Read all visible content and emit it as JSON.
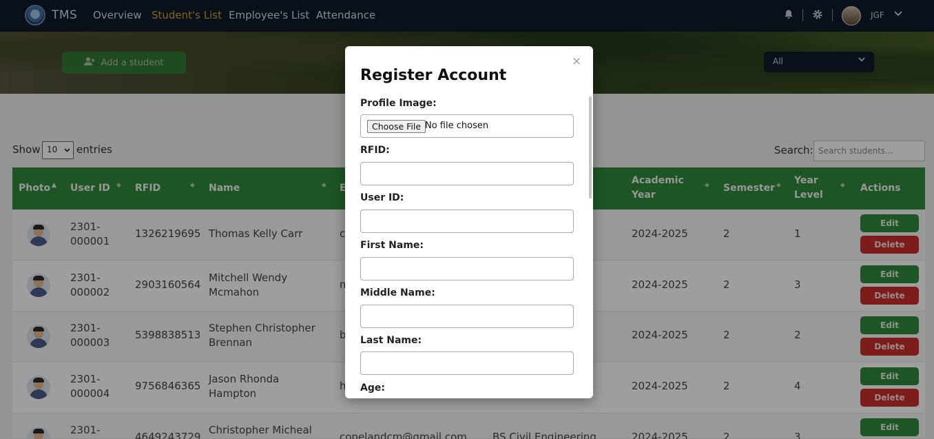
{
  "nav": {
    "brand": "TMS",
    "links": [
      "Overview",
      "Student's List",
      "Employee's List",
      "Attendance"
    ],
    "active_index": 1,
    "user": "JGF",
    "icons": [
      "bell-icon",
      "gear-icon",
      "chevron-down-icon"
    ]
  },
  "toolbar": {
    "add_label": "Add a student",
    "filter_value": "All"
  },
  "list": {
    "show_label": "Show",
    "page_size": "10",
    "entries_label": "entries",
    "search_label": "Search:",
    "search_placeholder": "Search students..."
  },
  "table": {
    "headers": {
      "photo": "Photo",
      "user_id": "User ID",
      "rfid": "RFID",
      "name": "Name",
      "email": "E",
      "academic_year": "Academic Year",
      "semester": "Semester",
      "year_level": "Year Level",
      "actions": "Actions"
    },
    "rows": [
      {
        "user_id": "2301-000001",
        "rfid": "1326219695",
        "name": "Thomas Kelly Carr",
        "email": "c",
        "course": "",
        "academic_year": "2024-2025",
        "semester": "2",
        "year_level": "1"
      },
      {
        "user_id": "2301-000002",
        "rfid": "2903160564",
        "name": "Mitchell Wendy Mcmahon",
        "email": "m",
        "course": "",
        "academic_year": "2024-2025",
        "semester": "2",
        "year_level": "3"
      },
      {
        "user_id": "2301-000003",
        "rfid": "5398838513",
        "name": "Stephen Christopher Brennan",
        "email": "b",
        "course": "",
        "academic_year": "2024-2025",
        "semester": "2",
        "year_level": "2"
      },
      {
        "user_id": "2301-000004",
        "rfid": "9756846365",
        "name": "Jason Rhonda Hampton",
        "email": "h",
        "course": "",
        "academic_year": "2024-2025",
        "semester": "2",
        "year_level": "4"
      },
      {
        "user_id": "2301-",
        "rfid": "4649243729",
        "name": "Christopher Micheal",
        "email": "copelandcm@gmail.com",
        "course": "BS Civil Engineering",
        "academic_year": "2024-2025",
        "semester": "2",
        "year_level": "3"
      }
    ],
    "edit_label": "Edit",
    "delete_label": "Delete"
  },
  "modal": {
    "title": "Register Account",
    "close": "×",
    "file_button": "Choose File",
    "file_status": "No file chosen",
    "fields": [
      "Profile Image:",
      "RFID:",
      "User ID:",
      "First Name:",
      "Middle Name:",
      "Last Name:",
      "Age:"
    ]
  },
  "colors": {
    "nav_bg": "#0f1a2b",
    "accent_active": "#d3a22a",
    "table_header": "#2f8a3a",
    "edit": "#2f8a3a",
    "delete": "#c9302c"
  }
}
